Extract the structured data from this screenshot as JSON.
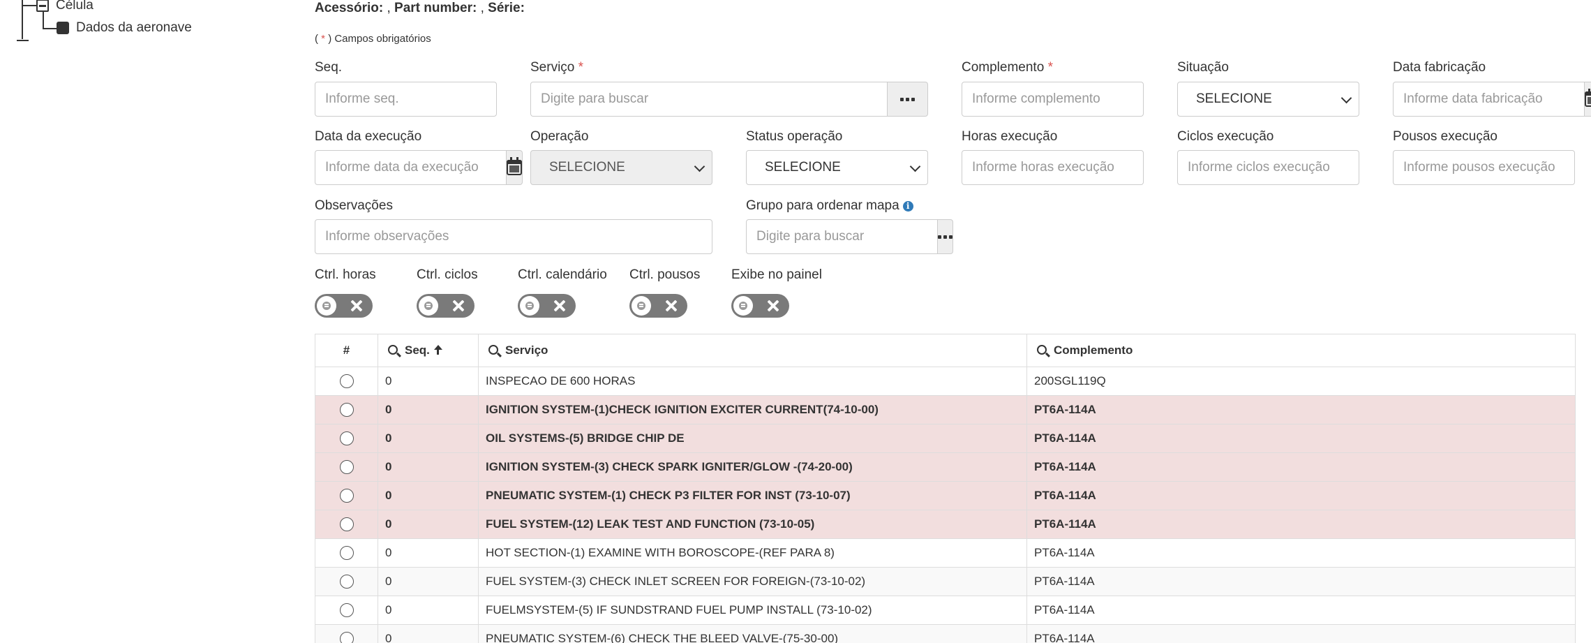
{
  "tree": {
    "items": [
      {
        "label": "Célula"
      },
      {
        "label": "Dados da aeronave"
      }
    ]
  },
  "header": {
    "accessory_label": "Acessório:",
    "accessory_value": ",",
    "part_number_label": "Part number:",
    "part_number_value": ",",
    "serie_label": "Série:",
    "required_note_open": "(",
    "required_star": "*",
    "required_note_close": ") Campos obrigatórios"
  },
  "form": {
    "seq": {
      "label": "Seq.",
      "placeholder": "Informe seq."
    },
    "servico": {
      "label": "Serviço",
      "required": "*",
      "placeholder": "Digite para buscar"
    },
    "complemento": {
      "label": "Complemento",
      "required": "*",
      "placeholder": "Informe complemento"
    },
    "situacao": {
      "label": "Situação",
      "value": "SELECIONE"
    },
    "data_fabricacao": {
      "label": "Data fabricação",
      "placeholder": "Informe data fabricação"
    },
    "data_execucao": {
      "label": "Data da execução",
      "placeholder": "Informe data da execução"
    },
    "operacao": {
      "label": "Operação",
      "value": "SELECIONE"
    },
    "status_operacao": {
      "label": "Status operação",
      "value": "SELECIONE"
    },
    "horas_execucao": {
      "label": "Horas execução",
      "placeholder": "Informe horas execução"
    },
    "ciclos_execucao": {
      "label": "Ciclos execução",
      "placeholder": "Informe ciclos execução"
    },
    "pousos_execucao": {
      "label": "Pousos execução",
      "placeholder": "Informe pousos execução"
    },
    "observacoes": {
      "label": "Observações",
      "placeholder": "Informe observações"
    },
    "grupo_mapa": {
      "label": "Grupo para ordenar mapa",
      "placeholder": "Digite para buscar"
    },
    "toggles": [
      {
        "label": "Ctrl. horas",
        "on": false
      },
      {
        "label": "Ctrl. ciclos",
        "on": false
      },
      {
        "label": "Ctrl. calendário",
        "on": false
      },
      {
        "label": "Ctrl. pousos",
        "on": false
      },
      {
        "label": "Exibe no painel",
        "on": false
      }
    ]
  },
  "table": {
    "columns": [
      "#",
      "Seq.",
      "Serviço",
      "Complemento"
    ],
    "rows": [
      {
        "seq": "0",
        "servico": "INSPECAO DE 600 HORAS",
        "complemento": "200SGL119Q",
        "highlight": false
      },
      {
        "seq": "0",
        "servico": "IGNITION SYSTEM-(1)CHECK IGNITION EXCITER CURRENT(74-10-00)",
        "complemento": "PT6A-114A",
        "highlight": true
      },
      {
        "seq": "0",
        "servico": "OIL SYSTEMS-(5) BRIDGE CHIP DE",
        "complemento": "PT6A-114A",
        "highlight": true
      },
      {
        "seq": "0",
        "servico": "IGNITION SYSTEM-(3) CHECK SPARK IGNITER/GLOW -(74-20-00)",
        "complemento": "PT6A-114A",
        "highlight": true
      },
      {
        "seq": "0",
        "servico": "PNEUMATIC SYSTEM-(1) CHECK P3 FILTER FOR INST (73-10-07)",
        "complemento": "PT6A-114A",
        "highlight": true
      },
      {
        "seq": "0",
        "servico": "FUEL SYSTEM-(12) LEAK TEST AND FUNCTION (73-10-05)",
        "complemento": "PT6A-114A",
        "highlight": true
      },
      {
        "seq": "0",
        "servico": "HOT SECTION-(1) EXAMINE WITH BOROSCOPE-(REF PARA 8)",
        "complemento": "PT6A-114A",
        "highlight": false
      },
      {
        "seq": "0",
        "servico": "FUEL SYSTEM-(3) CHECK INLET SCREEN FOR FOREIGN-(73-10-02)",
        "complemento": "PT6A-114A",
        "highlight": false
      },
      {
        "seq": "0",
        "servico": "FUELMSYSTEM-(5) IF SUNDSTRAND FUEL PUMP INSTALL (73-10-02)",
        "complemento": "PT6A-114A",
        "highlight": false
      },
      {
        "seq": "0",
        "servico": "PNEUMATIC SYSTEM-(6) CHECK THE BLEED VALVE-(75-30-00)",
        "complemento": "PT6A-114A",
        "highlight": false
      }
    ]
  },
  "colors": {
    "highlight_row": "#f2dede",
    "required": "#d9534f",
    "info_icon": "#2f7ab8",
    "toggle_off": "#7a7a7a"
  }
}
